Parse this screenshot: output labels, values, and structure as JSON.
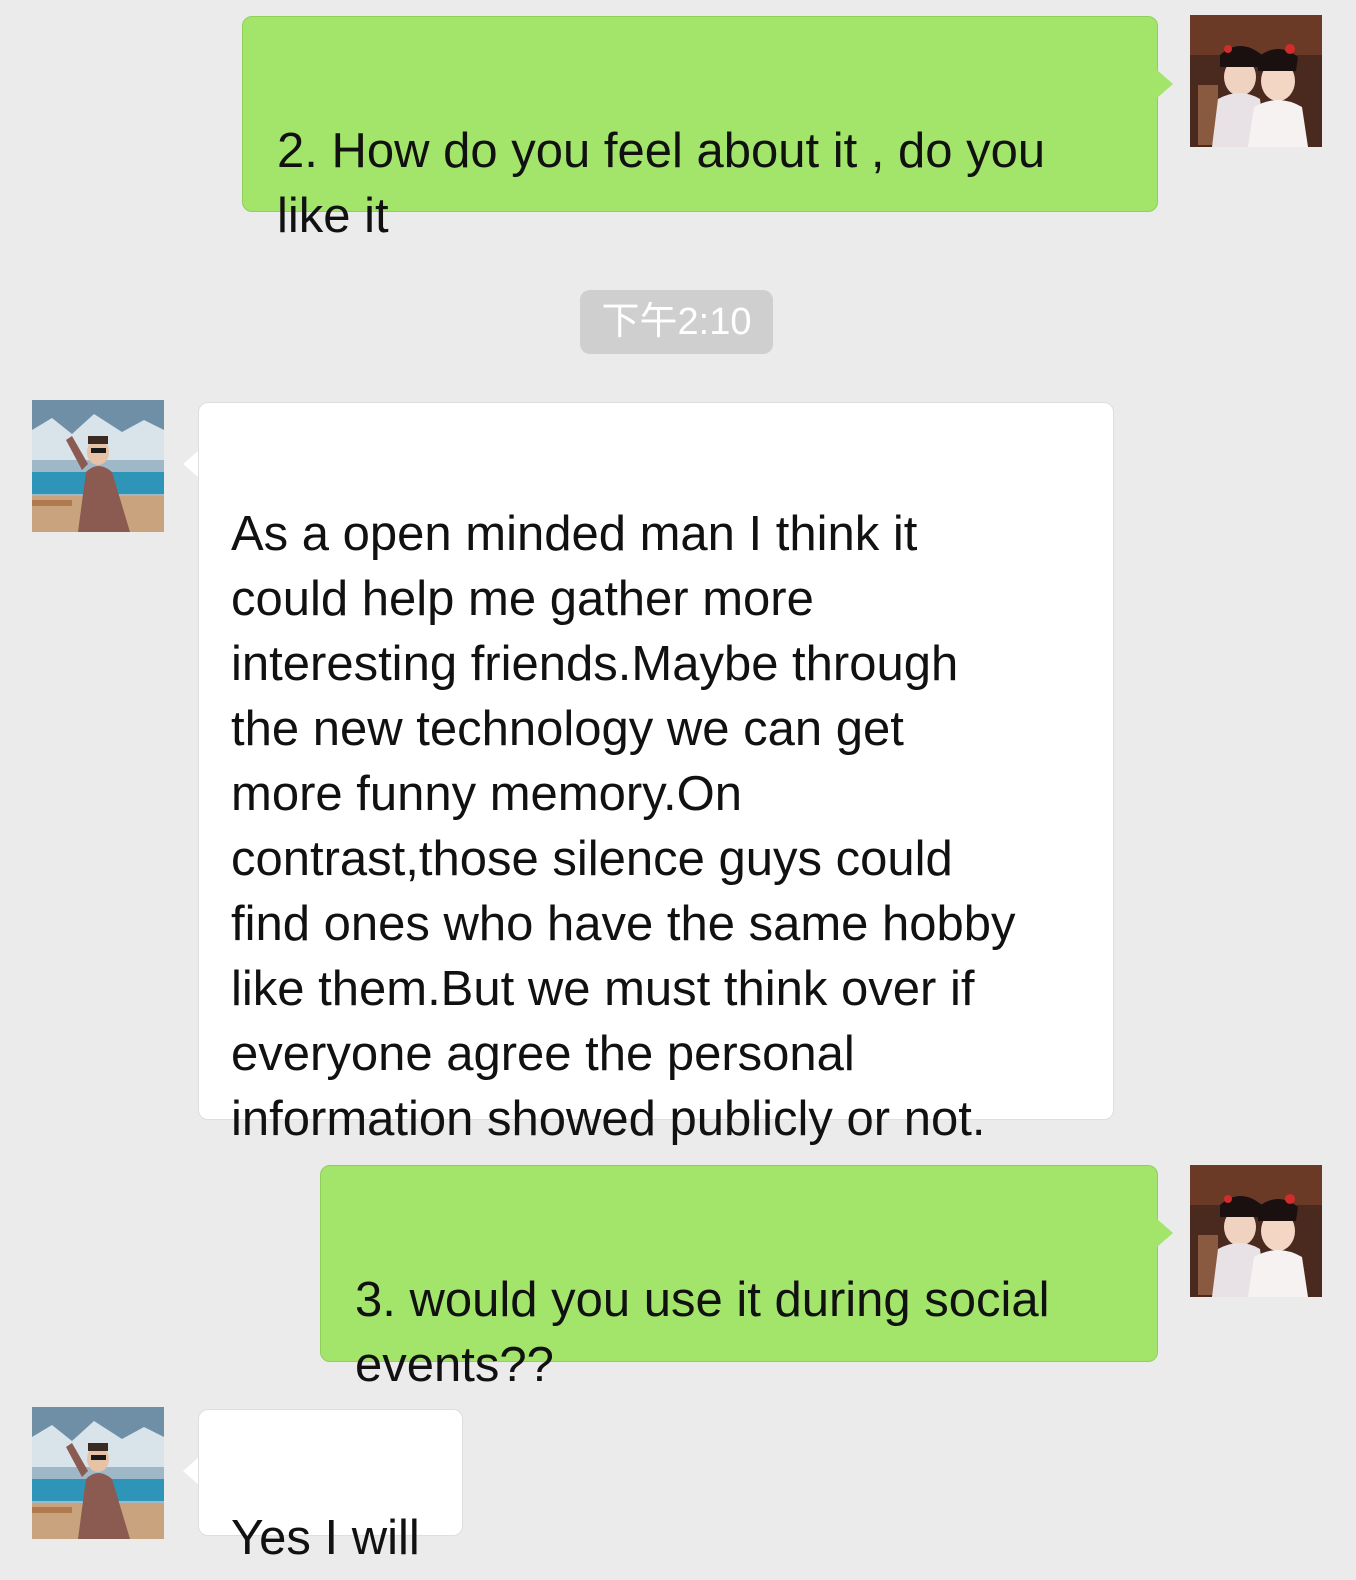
{
  "chat": {
    "timestamp": "下午2:10",
    "messages": [
      {
        "sender": "me",
        "text": "2. How do you feel about it , do you\nlike it"
      },
      {
        "sender": "contact",
        "text": "As a open minded man I think it\ncould help me gather more\ninteresting friends.Maybe through\nthe new technology we can get\nmore funny memory.On\ncontrast,those silence guys could\nfind ones who have the same hobby\n like them.But we must think over if\neveryone agree the personal\ninformation showed publicly or not."
      },
      {
        "sender": "me",
        "text": "3. would you use it during social\nevents??"
      },
      {
        "sender": "contact",
        "text": "Yes I will"
      }
    ]
  },
  "avatars": {
    "me": "portrait-avatar-icon",
    "contact": "outdoor-photo-avatar-icon"
  },
  "colors": {
    "background": "#ebebeb",
    "sent_bubble": "#a3e46b",
    "received_bubble": "#ffffff",
    "timestamp_bg": "#cfcfcf"
  }
}
